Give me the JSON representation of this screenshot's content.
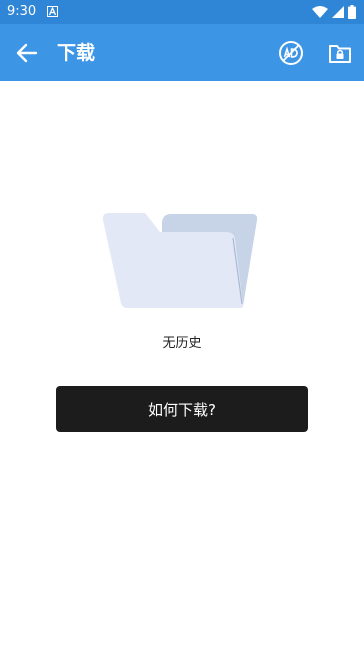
{
  "status_bar": {
    "time": "9:30"
  },
  "app_bar": {
    "title": "下载"
  },
  "empty_state": {
    "message": "无历史"
  },
  "actions": {
    "how_to_download": "如何下载?"
  },
  "colors": {
    "status_bar": "#2f86d6",
    "app_bar": "#3d95e6",
    "button": "#1c1c1c"
  }
}
